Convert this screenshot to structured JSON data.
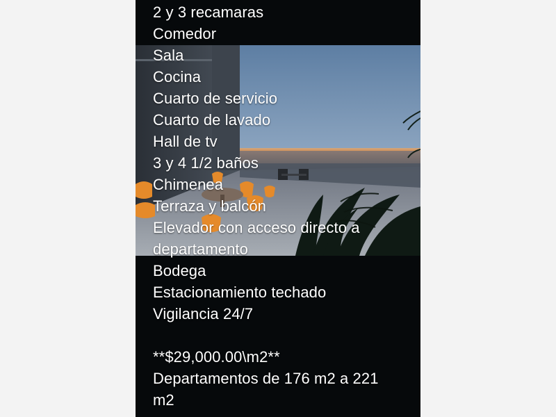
{
  "listing": {
    "features": [
      "2 y 3 recamaras",
      "Comedor",
      "Sala",
      "Cocina",
      "Cuarto de servicio",
      "Cuarto de lavado",
      "Hall de tv",
      "3 y 4 1/2 baños",
      "Chimenea",
      "Terraza y balcón",
      "Elevador con acceso directo a",
      "departamento",
      "Bodega",
      "Estacionamiento techado",
      "Vigilancia 24/7"
    ],
    "price": "**$29,000.00\\m2**",
    "size_line_1": "Departamentos de 176 m2 a 221",
    "size_line_2": "m2"
  },
  "colors": {
    "page_background": "#f3f3f3",
    "panel_background": "#06090b",
    "text": "#ffffff",
    "sky": "#6f8fb2",
    "horizon_glow": "#f0a55e",
    "chair_orange": "#e58a2a"
  }
}
